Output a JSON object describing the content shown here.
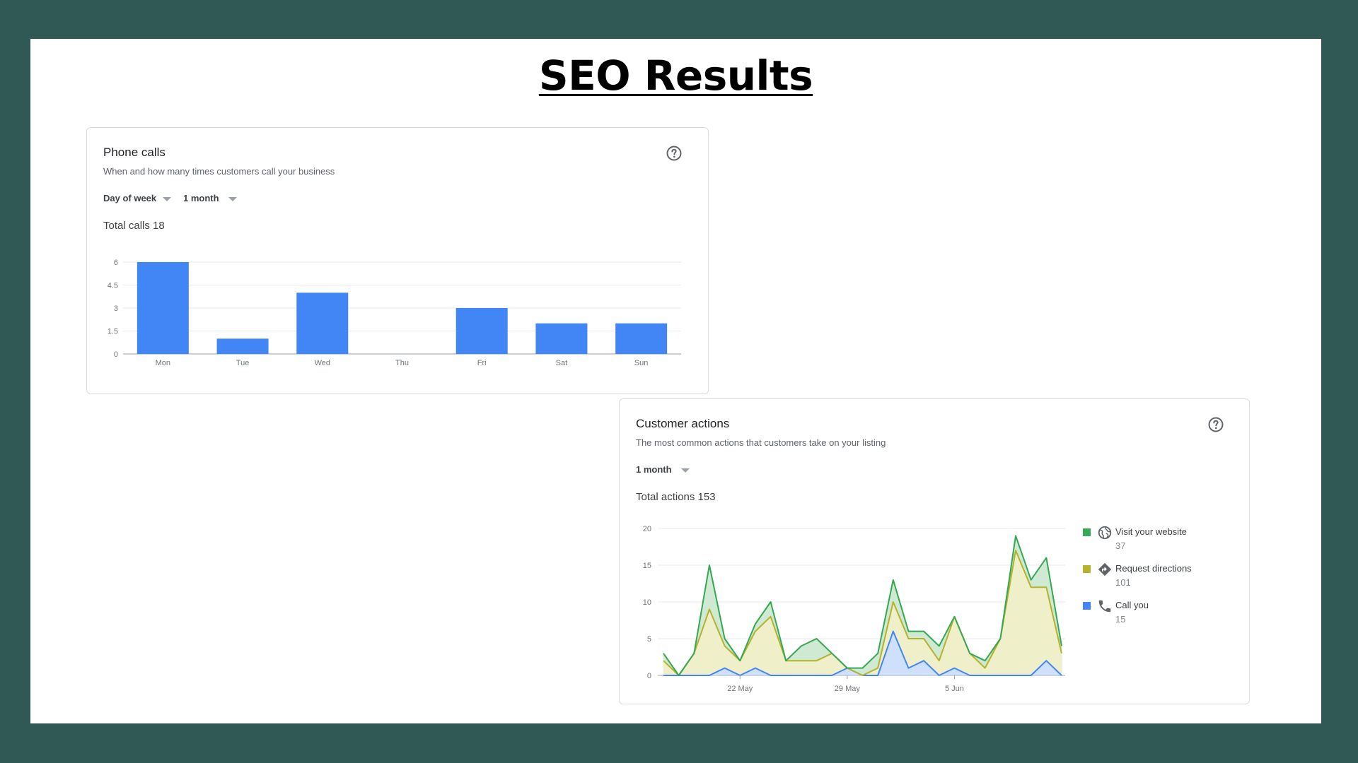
{
  "slide_title": "SEO Results",
  "phone_calls": {
    "title": "Phone calls",
    "subtitle": "When and how many times customers call your business",
    "dropdown_group": "Day of week",
    "dropdown_range": "1 month",
    "total_label": "Total calls 18"
  },
  "customer_actions": {
    "title": "Customer actions",
    "subtitle": "The most common actions that customers take on your listing",
    "dropdown_range": "1 month",
    "total_label": "Total actions 153",
    "legend": [
      {
        "label": "Visit your website",
        "value": "37",
        "color": "#34a853",
        "icon": "globe-icon"
      },
      {
        "label": "Request directions",
        "value": "101",
        "color": "#b5b22c",
        "icon": "directions-icon"
      },
      {
        "label": "Call you",
        "value": "15",
        "color": "#4285f4",
        "icon": "phone-icon"
      }
    ]
  },
  "chart_data": [
    {
      "type": "bar",
      "categories": [
        "Mon",
        "Tue",
        "Wed",
        "Thu",
        "Fri",
        "Sat",
        "Sun"
      ],
      "values": [
        6,
        1,
        4,
        0,
        3,
        2,
        2
      ],
      "y_ticks": [
        "0",
        "1.5",
        "3",
        "4.5",
        "6"
      ],
      "ylim": [
        0,
        6
      ],
      "grid": true,
      "bar_color": "#4285f4"
    },
    {
      "type": "area",
      "x_labels": [
        "22 May",
        "29 May",
        "5 Jun"
      ],
      "x_label_days": [
        5,
        12,
        19
      ],
      "y_ticks": [
        "0",
        "5",
        "10",
        "15",
        "20"
      ],
      "ylim": [
        0,
        20
      ],
      "grid": true,
      "stacked": true,
      "series": [
        {
          "name": "Call you",
          "color": "#4285f4",
          "fill": "#cfe0fc",
          "values": [
            0,
            0,
            0,
            0,
            1,
            0,
            1,
            0,
            0,
            0,
            0,
            0,
            1,
            0,
            0,
            6,
            1,
            2,
            0,
            1,
            0,
            0,
            0,
            0,
            0,
            2,
            0
          ]
        },
        {
          "name": "Request directions",
          "color": "#b5b22c",
          "fill": "#efefca",
          "values": [
            2,
            0,
            3,
            9,
            3,
            2,
            5,
            8,
            2,
            2,
            2,
            3,
            0,
            0,
            1,
            4,
            4,
            3,
            2,
            7,
            3,
            1,
            5,
            17,
            12,
            10,
            3
          ]
        },
        {
          "name": "Visit your website",
          "color": "#34a853",
          "fill": "#cfe9d3",
          "values": [
            1,
            0,
            0,
            6,
            1,
            0,
            1,
            2,
            0,
            2,
            3,
            0,
            0,
            1,
            2,
            3,
            1,
            1,
            2,
            0,
            0,
            1,
            0,
            2,
            1,
            4,
            1
          ]
        }
      ]
    }
  ]
}
